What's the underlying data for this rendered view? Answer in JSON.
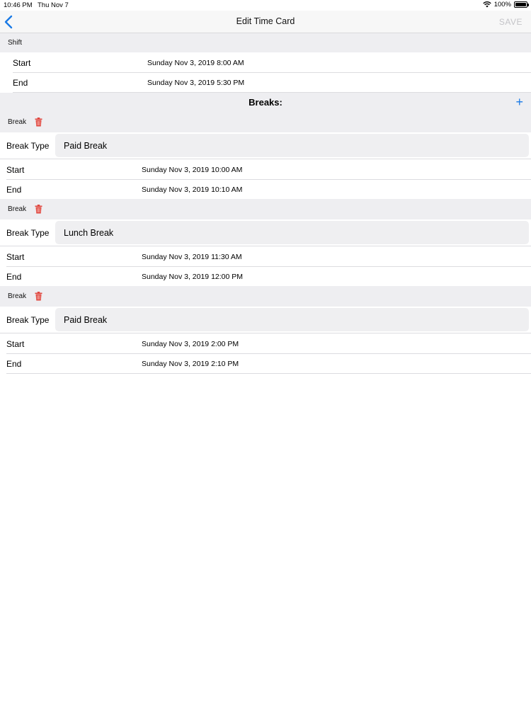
{
  "status_bar": {
    "time": "10:46 PM",
    "date": "Thu Nov 7",
    "battery": "100%",
    "battery_level": 1.0
  },
  "nav": {
    "title": "Edit Time Card",
    "save_label": "SAVE"
  },
  "shift": {
    "header": "Shift",
    "rows": [
      {
        "label": "Start",
        "value": "Sunday Nov 3, 2019 8:00 AM"
      },
      {
        "label": "End",
        "value": "Sunday Nov 3, 2019 5:30 PM"
      }
    ]
  },
  "breaks_section": {
    "title": "Breaks:",
    "add_label": "+"
  },
  "breaks": [
    {
      "header": "Break",
      "type_label": "Break Type",
      "type_value": "Paid Break",
      "start_label": "Start",
      "start_value": "Sunday Nov 3, 2019 10:00 AM",
      "end_label": "End",
      "end_value": "Sunday Nov 3, 2019 10:10 AM"
    },
    {
      "header": "Break",
      "type_label": "Break Type",
      "type_value": "Lunch Break",
      "start_label": "Start",
      "start_value": "Sunday Nov 3, 2019 11:30 AM",
      "end_label": "End",
      "end_value": "Sunday Nov 3, 2019 12:00 PM"
    },
    {
      "header": "Break",
      "type_label": "Break Type",
      "type_value": "Paid Break",
      "start_label": "Start",
      "start_value": "Sunday Nov 3, 2019 2:00 PM",
      "end_label": "End",
      "end_value": "Sunday Nov 3, 2019 2:10 PM"
    }
  ],
  "icons": {
    "back": "chevron-left-icon",
    "wifi": "wifi-icon",
    "battery": "battery-icon",
    "trash": "trash-icon",
    "add": "plus-icon"
  },
  "colors": {
    "accent": "#1a7ae6",
    "delete": "#e0473f",
    "disabled": "#c4c4c8",
    "section_bg": "#eeeef1"
  }
}
